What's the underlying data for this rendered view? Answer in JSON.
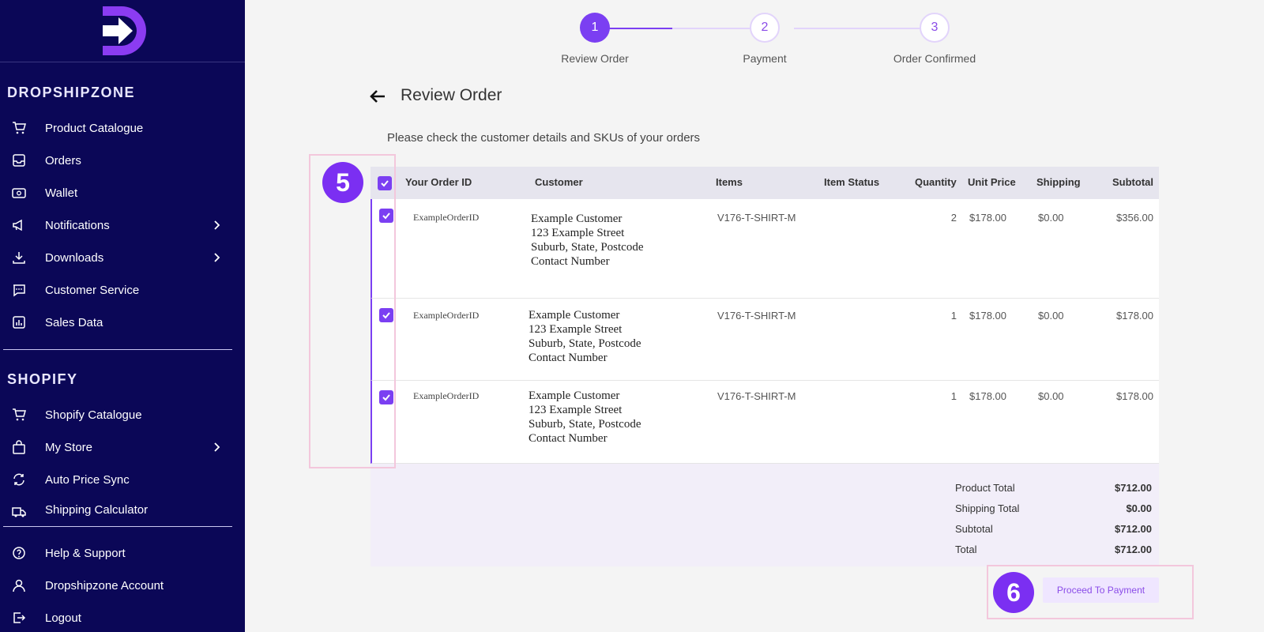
{
  "sidebar": {
    "brand_section": "DROPSHIPZONE",
    "shopify_section": "SHOPIFY",
    "items": [
      {
        "label": "Product Catalogue",
        "icon": "cart-icon"
      },
      {
        "label": "Orders",
        "icon": "inbox-icon"
      },
      {
        "label": "Wallet",
        "icon": "wallet-icon"
      },
      {
        "label": "Notifications",
        "icon": "megaphone-icon"
      },
      {
        "label": "Downloads",
        "icon": "download-icon"
      },
      {
        "label": "Customer Service",
        "icon": "chat-icon"
      },
      {
        "label": "Sales Data",
        "icon": "chart-icon"
      },
      {
        "label": "Shopify Catalogue",
        "icon": "cart-icon"
      },
      {
        "label": "My Store",
        "icon": "bag-icon"
      },
      {
        "label": "Auto Price Sync",
        "icon": "sync-icon"
      },
      {
        "label": "Shipping Calculator",
        "icon": "truck-icon"
      },
      {
        "label": "Help & Support",
        "icon": "help-icon"
      },
      {
        "label": "Dropshipzone Account",
        "icon": "user-icon"
      },
      {
        "label": "Logout",
        "icon": "logout-icon"
      }
    ]
  },
  "stepper": {
    "steps": [
      {
        "number": "1",
        "label": "Review Order"
      },
      {
        "number": "2",
        "label": "Payment"
      },
      {
        "number": "3",
        "label": "Order Confirmed"
      }
    ]
  },
  "header": {
    "title": "Review Order",
    "subtitle": "Please check the customer details and SKUs of your orders"
  },
  "table": {
    "columns": [
      "Your Order ID",
      "Customer",
      "Items",
      "Item Status",
      "Quantity",
      "Unit Price",
      "Shipping",
      "Subtotal"
    ],
    "rows": [
      {
        "order_id": "ExampleOrderID",
        "customer": [
          "Example Customer",
          "123 Example Street",
          "Suburb, State, Postcode",
          "Contact Number"
        ],
        "item": "V176-T-SHIRT-M",
        "status": "",
        "quantity": "2",
        "unit_price": "$178.00",
        "shipping": "$0.00",
        "subtotal": "$356.00"
      },
      {
        "order_id": "ExampleOrderID",
        "customer": [
          "Example Customer",
          "123 Example Street",
          "Suburb, State, Postcode",
          "Contact Number"
        ],
        "item": "V176-T-SHIRT-M",
        "status": "",
        "quantity": "1",
        "unit_price": "$178.00",
        "shipping": "$0.00",
        "subtotal": "$178.00"
      },
      {
        "order_id": "ExampleOrderID",
        "customer": [
          "Example Customer",
          "123 Example Street",
          "Suburb, State, Postcode",
          "Contact Number"
        ],
        "item": "V176-T-SHIRT-M",
        "status": "",
        "quantity": "1",
        "unit_price": "$178.00",
        "shipping": "$0.00",
        "subtotal": "$178.00"
      }
    ]
  },
  "totals": {
    "product_total_label": "Product Total",
    "product_total": "$712.00",
    "shipping_total_label": "Shipping Total",
    "shipping_total": "$0.00",
    "subtotal_label": "Subtotal",
    "subtotal": "$712.00",
    "total_label": "Total",
    "total": "$712.00"
  },
  "annotations": {
    "a5": "5",
    "a6": "6"
  },
  "actions": {
    "proceed_label": "Proceed To Payment"
  },
  "colors": {
    "sidebar": "#0b0757",
    "accent": "#7b3ff2",
    "annotation": "#7b2ff2",
    "highlight": "#f3c7dc"
  }
}
